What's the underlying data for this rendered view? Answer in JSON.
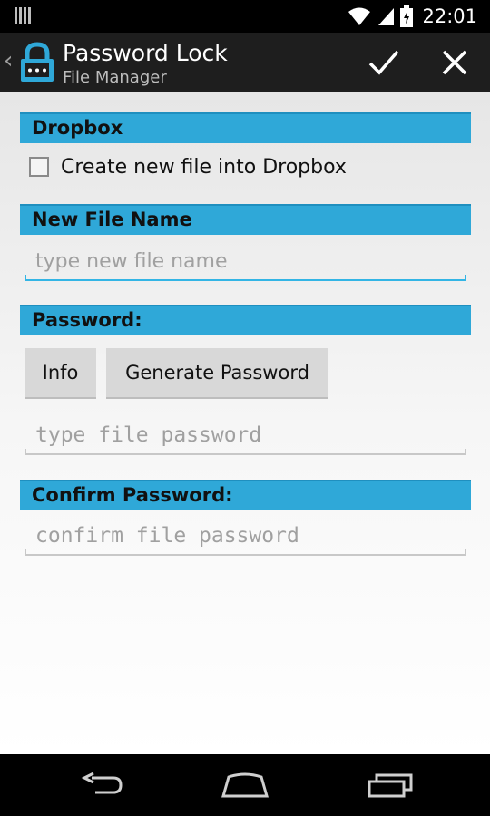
{
  "status_bar": {
    "time": "22:01"
  },
  "action_bar": {
    "title": "Password Lock",
    "subtitle": "File Manager"
  },
  "dropbox_section": {
    "header": "Dropbox",
    "checkbox_label": "Create new file into Dropbox",
    "checked": false
  },
  "new_file_section": {
    "header": "New File Name",
    "placeholder": "type new file name",
    "value": ""
  },
  "password_section": {
    "header": "Password:",
    "info_button": "Info",
    "generate_button": "Generate Password",
    "placeholder": "type file password",
    "value": ""
  },
  "confirm_section": {
    "header": "Confirm Password:",
    "placeholder": "confirm file password",
    "value": ""
  },
  "icons": [
    "notification-icon",
    "wifi-icon",
    "signal-icon",
    "battery-icon",
    "lock-app-icon",
    "check-icon",
    "close-icon",
    "back-nav-icon",
    "home-nav-icon",
    "recents-nav-icon"
  ],
  "colors": {
    "section_header": "#2fa8d8",
    "focus_underline": "#33b5e5",
    "action_bar": "#1e1e1e"
  }
}
